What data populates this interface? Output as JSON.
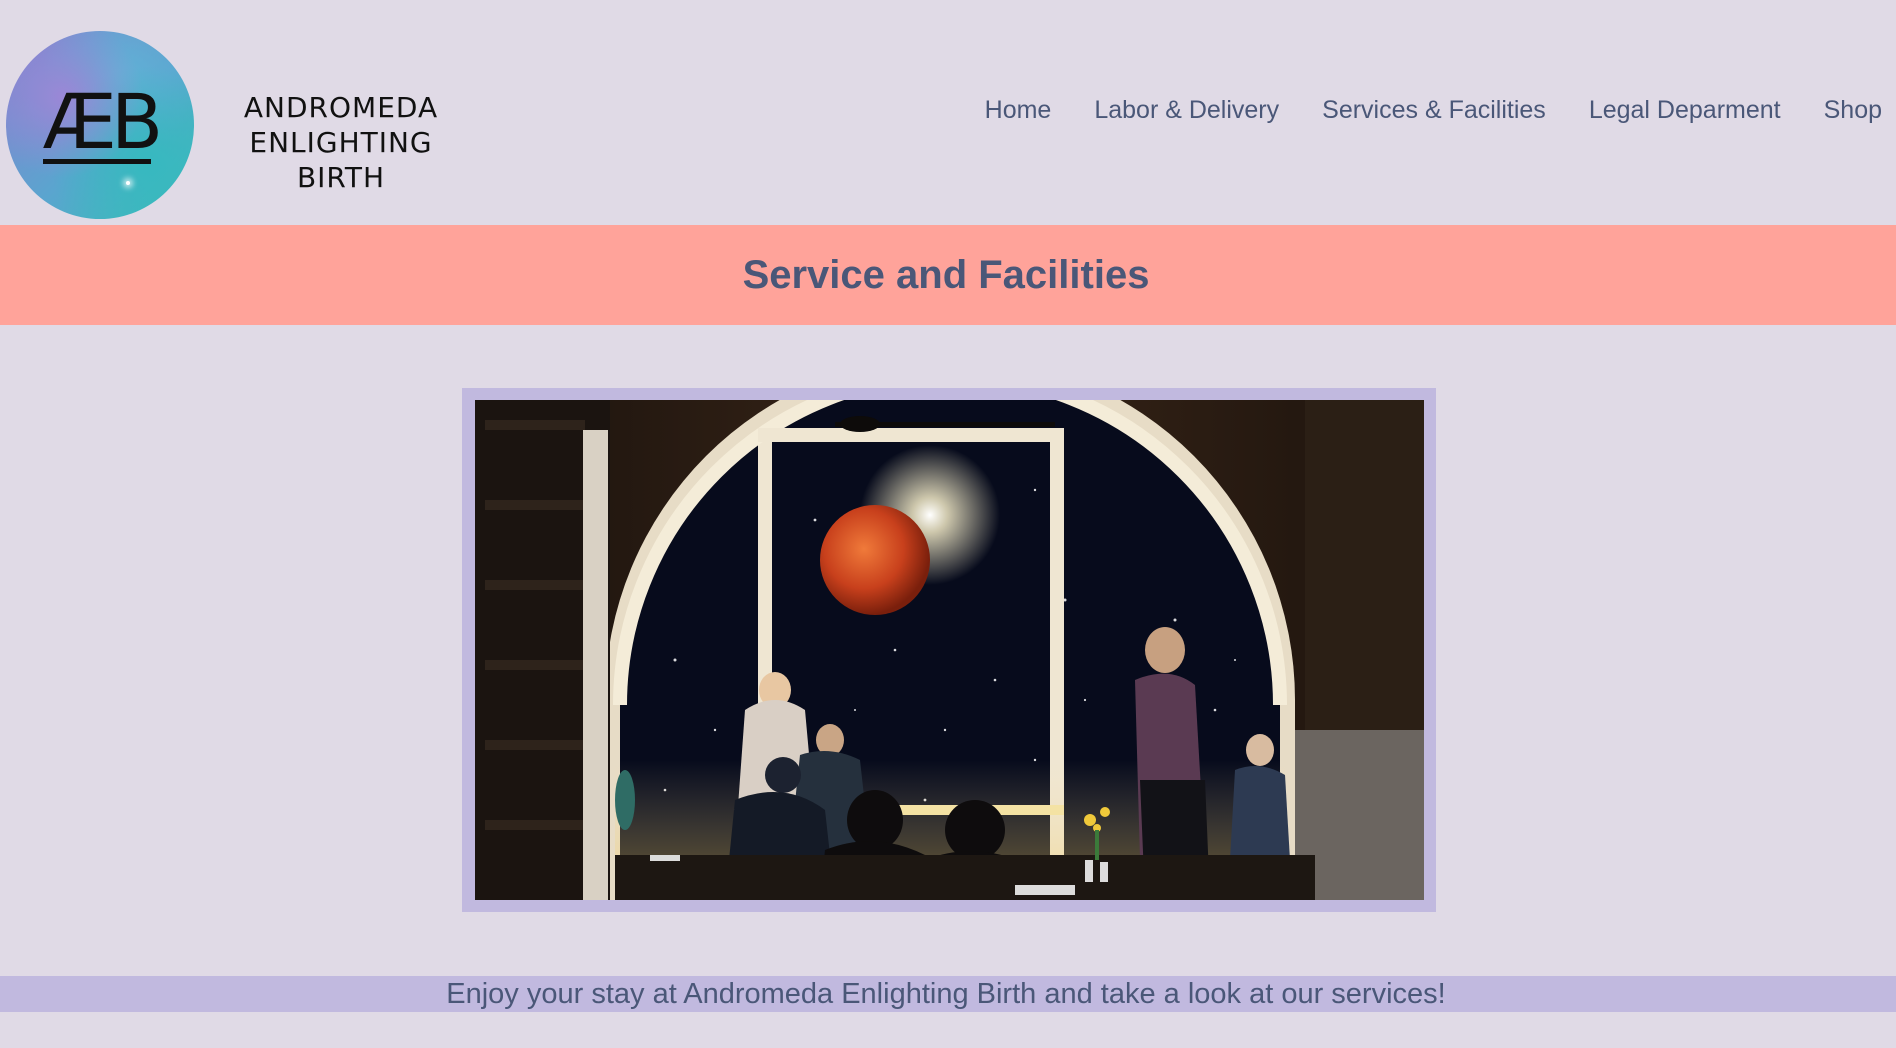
{
  "logo": {
    "mark": "ÆB",
    "name_line1": "ANDROMEDA",
    "name_line2": "ENLIGHTING BIRTH"
  },
  "nav": {
    "items": [
      {
        "label": "Home"
      },
      {
        "label": "Labor & Delivery"
      },
      {
        "label": "Services & Facilities"
      },
      {
        "label": "Legal Deparment"
      },
      {
        "label": "Shop"
      }
    ]
  },
  "banner": {
    "title": "Service and Facilities"
  },
  "feature": {
    "image_description": "restaurant-window-moon-photo"
  },
  "footer_strip": {
    "text": "Enjoy your stay at Andromeda Enlighting Birth and take a look at our services!"
  },
  "colors": {
    "background": "#e0dae6",
    "banner": "#ffa39a",
    "frame": "#c1b9df",
    "text": "#4a5778"
  }
}
